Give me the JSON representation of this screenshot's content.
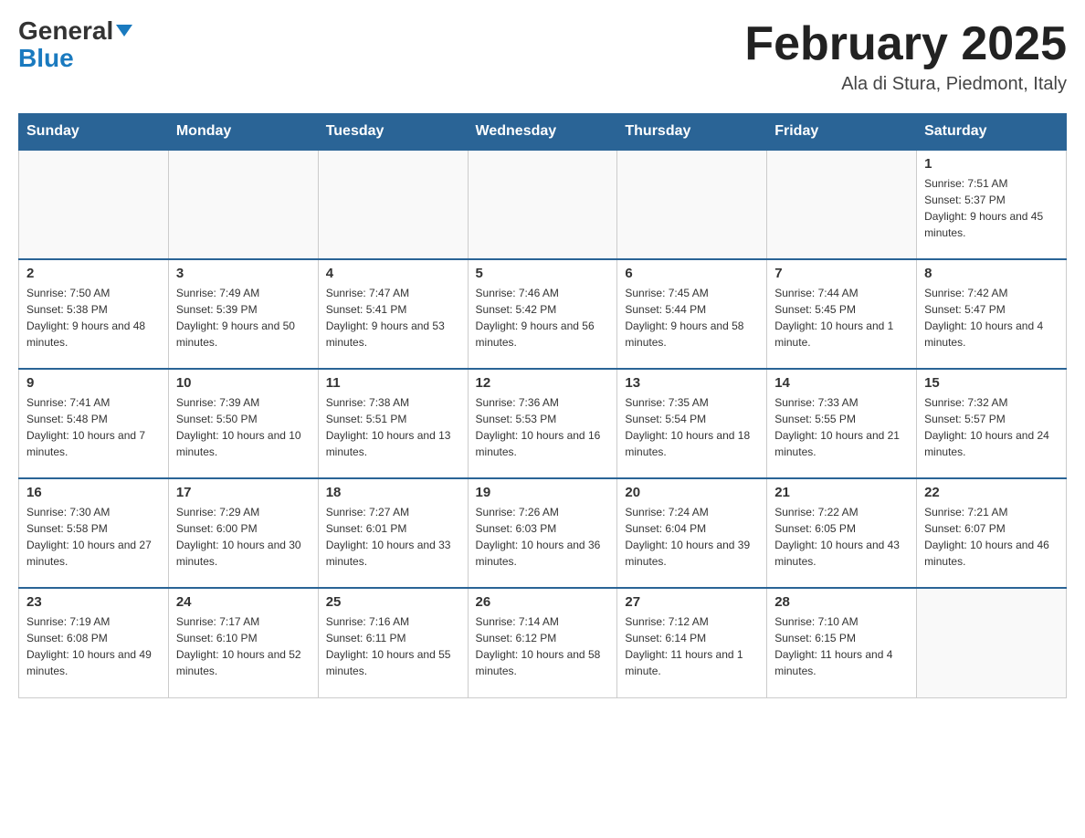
{
  "logo": {
    "general": "General",
    "blue": "Blue"
  },
  "title": "February 2025",
  "location": "Ala di Stura, Piedmont, Italy",
  "days_of_week": [
    "Sunday",
    "Monday",
    "Tuesday",
    "Wednesday",
    "Thursday",
    "Friday",
    "Saturday"
  ],
  "weeks": [
    [
      {
        "day": "",
        "info": ""
      },
      {
        "day": "",
        "info": ""
      },
      {
        "day": "",
        "info": ""
      },
      {
        "day": "",
        "info": ""
      },
      {
        "day": "",
        "info": ""
      },
      {
        "day": "",
        "info": ""
      },
      {
        "day": "1",
        "info": "Sunrise: 7:51 AM\nSunset: 5:37 PM\nDaylight: 9 hours and 45 minutes."
      }
    ],
    [
      {
        "day": "2",
        "info": "Sunrise: 7:50 AM\nSunset: 5:38 PM\nDaylight: 9 hours and 48 minutes."
      },
      {
        "day": "3",
        "info": "Sunrise: 7:49 AM\nSunset: 5:39 PM\nDaylight: 9 hours and 50 minutes."
      },
      {
        "day": "4",
        "info": "Sunrise: 7:47 AM\nSunset: 5:41 PM\nDaylight: 9 hours and 53 minutes."
      },
      {
        "day": "5",
        "info": "Sunrise: 7:46 AM\nSunset: 5:42 PM\nDaylight: 9 hours and 56 minutes."
      },
      {
        "day": "6",
        "info": "Sunrise: 7:45 AM\nSunset: 5:44 PM\nDaylight: 9 hours and 58 minutes."
      },
      {
        "day": "7",
        "info": "Sunrise: 7:44 AM\nSunset: 5:45 PM\nDaylight: 10 hours and 1 minute."
      },
      {
        "day": "8",
        "info": "Sunrise: 7:42 AM\nSunset: 5:47 PM\nDaylight: 10 hours and 4 minutes."
      }
    ],
    [
      {
        "day": "9",
        "info": "Sunrise: 7:41 AM\nSunset: 5:48 PM\nDaylight: 10 hours and 7 minutes."
      },
      {
        "day": "10",
        "info": "Sunrise: 7:39 AM\nSunset: 5:50 PM\nDaylight: 10 hours and 10 minutes."
      },
      {
        "day": "11",
        "info": "Sunrise: 7:38 AM\nSunset: 5:51 PM\nDaylight: 10 hours and 13 minutes."
      },
      {
        "day": "12",
        "info": "Sunrise: 7:36 AM\nSunset: 5:53 PM\nDaylight: 10 hours and 16 minutes."
      },
      {
        "day": "13",
        "info": "Sunrise: 7:35 AM\nSunset: 5:54 PM\nDaylight: 10 hours and 18 minutes."
      },
      {
        "day": "14",
        "info": "Sunrise: 7:33 AM\nSunset: 5:55 PM\nDaylight: 10 hours and 21 minutes."
      },
      {
        "day": "15",
        "info": "Sunrise: 7:32 AM\nSunset: 5:57 PM\nDaylight: 10 hours and 24 minutes."
      }
    ],
    [
      {
        "day": "16",
        "info": "Sunrise: 7:30 AM\nSunset: 5:58 PM\nDaylight: 10 hours and 27 minutes."
      },
      {
        "day": "17",
        "info": "Sunrise: 7:29 AM\nSunset: 6:00 PM\nDaylight: 10 hours and 30 minutes."
      },
      {
        "day": "18",
        "info": "Sunrise: 7:27 AM\nSunset: 6:01 PM\nDaylight: 10 hours and 33 minutes."
      },
      {
        "day": "19",
        "info": "Sunrise: 7:26 AM\nSunset: 6:03 PM\nDaylight: 10 hours and 36 minutes."
      },
      {
        "day": "20",
        "info": "Sunrise: 7:24 AM\nSunset: 6:04 PM\nDaylight: 10 hours and 39 minutes."
      },
      {
        "day": "21",
        "info": "Sunrise: 7:22 AM\nSunset: 6:05 PM\nDaylight: 10 hours and 43 minutes."
      },
      {
        "day": "22",
        "info": "Sunrise: 7:21 AM\nSunset: 6:07 PM\nDaylight: 10 hours and 46 minutes."
      }
    ],
    [
      {
        "day": "23",
        "info": "Sunrise: 7:19 AM\nSunset: 6:08 PM\nDaylight: 10 hours and 49 minutes."
      },
      {
        "day": "24",
        "info": "Sunrise: 7:17 AM\nSunset: 6:10 PM\nDaylight: 10 hours and 52 minutes."
      },
      {
        "day": "25",
        "info": "Sunrise: 7:16 AM\nSunset: 6:11 PM\nDaylight: 10 hours and 55 minutes."
      },
      {
        "day": "26",
        "info": "Sunrise: 7:14 AM\nSunset: 6:12 PM\nDaylight: 10 hours and 58 minutes."
      },
      {
        "day": "27",
        "info": "Sunrise: 7:12 AM\nSunset: 6:14 PM\nDaylight: 11 hours and 1 minute."
      },
      {
        "day": "28",
        "info": "Sunrise: 7:10 AM\nSunset: 6:15 PM\nDaylight: 11 hours and 4 minutes."
      },
      {
        "day": "",
        "info": ""
      }
    ]
  ]
}
